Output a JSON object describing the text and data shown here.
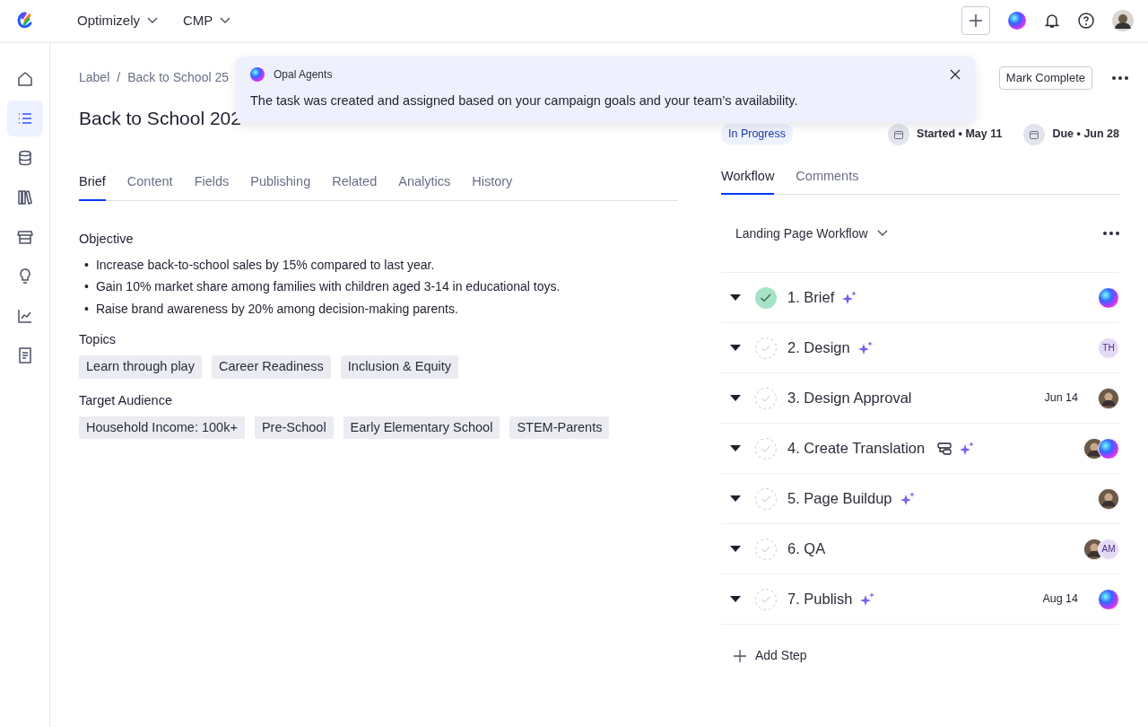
{
  "topbar": {
    "menus": [
      "Optimizely",
      "CMP"
    ]
  },
  "sidebar": {
    "items": [
      {
        "selected": false
      },
      {
        "selected": true
      },
      {
        "selected": false
      },
      {
        "selected": false
      },
      {
        "selected": false
      },
      {
        "selected": false
      },
      {
        "selected": false
      },
      {
        "selected": false
      }
    ]
  },
  "breadcrumb": {
    "items": [
      "Label",
      "Back to School 25"
    ],
    "separator": "/"
  },
  "title": "Back to School 202",
  "toast": {
    "title": "Opal Agents",
    "message": "The task was created and assigned based on your campaign goals and your team’s availability."
  },
  "tabs": [
    {
      "label": "Brief",
      "selected": true
    },
    {
      "label": "Content",
      "selected": false
    },
    {
      "label": "Fields",
      "selected": false
    },
    {
      "label": "Publishing",
      "selected": false
    },
    {
      "label": "Related",
      "selected": false
    },
    {
      "label": "Analytics",
      "selected": false
    },
    {
      "label": "History",
      "selected": false
    }
  ],
  "brief": {
    "objective": {
      "heading": "Objective",
      "marker": "•",
      "items": [
        "Increase back-to-school sales by 15% compared to last year.",
        "Gain 10% market share among families with children aged 3-14 in educational toys.",
        "Raise brand awareness by 20% among decision-making parents."
      ]
    },
    "topics": {
      "heading": "Topics",
      "tags": [
        "Learn through play",
        "Career Readiness",
        "Inclusion & Equity"
      ]
    },
    "audience": {
      "heading": "Target Audience",
      "tags": [
        "Household Income: 100k+",
        "Pre-School",
        "Early Elementary School",
        "STEM-Parents"
      ]
    }
  },
  "actions": {
    "mark_complete": "Mark Complete"
  },
  "status": "In Progress",
  "dates": [
    "Started • May 11",
    "Due • Jun 28"
  ],
  "right_tabs": [
    {
      "label": "Workflow",
      "selected": true
    },
    {
      "label": "Comments",
      "selected": false
    }
  ],
  "workflow": {
    "name": "Landing Page Workflow",
    "steps": [
      {
        "title": "1. Brief",
        "checked": true,
        "ai": true,
        "subtasks": false,
        "assignees": [
          {
            "kind": "orb"
          }
        ]
      },
      {
        "title": "2. Design",
        "checked": false,
        "ai": true,
        "subtasks": false,
        "assignees": [
          {
            "kind": "initials",
            "text": "TH"
          }
        ]
      },
      {
        "title": "3. Design Approval",
        "checked": false,
        "ai": false,
        "subtasks": false,
        "date": "Jun 14",
        "assignees": [
          {
            "kind": "person"
          }
        ]
      },
      {
        "title": "4. Create Translation",
        "checked": false,
        "ai": true,
        "subtasks": true,
        "assignees": [
          {
            "kind": "person"
          },
          {
            "kind": "orb"
          }
        ]
      },
      {
        "title": "5. Page Buildup",
        "checked": false,
        "ai": true,
        "subtasks": false,
        "assignees": [
          {
            "kind": "person"
          }
        ]
      },
      {
        "title": "6. QA",
        "checked": false,
        "ai": false,
        "subtasks": false,
        "assignees": [
          {
            "kind": "person"
          },
          {
            "kind": "initials",
            "text": "AM"
          }
        ]
      },
      {
        "title": "7. Publish",
        "checked": false,
        "ai": true,
        "subtasks": false,
        "date": "Aug 14",
        "assignees": [
          {
            "kind": "orb"
          }
        ]
      }
    ],
    "add_label": "Add Step"
  }
}
